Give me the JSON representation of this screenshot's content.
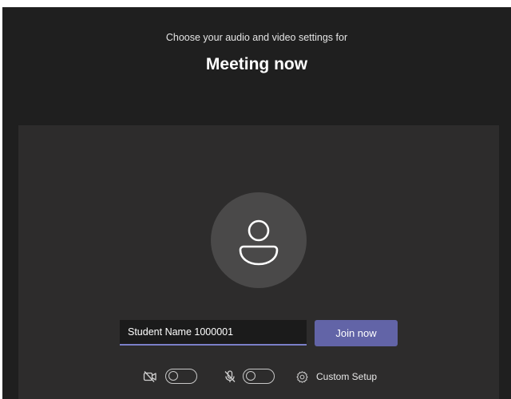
{
  "header": {
    "subtitle": "Choose your audio and video settings for",
    "title": "Meeting now"
  },
  "join": {
    "name_value": "Student Name 1000001",
    "button_label": "Join now"
  },
  "controls": {
    "camera": {
      "icon": "camera-off-icon",
      "enabled": false
    },
    "microphone": {
      "icon": "mic-off-icon",
      "enabled": false
    },
    "custom_setup": {
      "icon": "gear-icon",
      "label": "Custom Setup"
    }
  },
  "colors": {
    "background": "#1f1f1f",
    "stage": "#2d2c2c",
    "avatar": "#4a4949",
    "accent": "#6264a7",
    "input_underline": "#7b7fc8"
  }
}
